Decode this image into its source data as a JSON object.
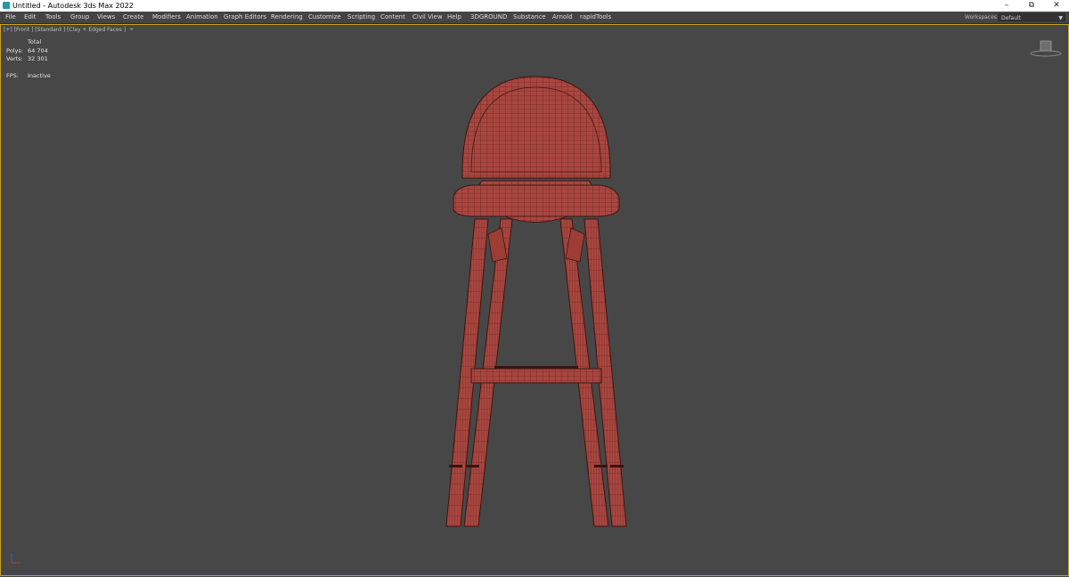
{
  "window": {
    "title": "Untitled - Autodesk 3ds Max 2022",
    "min": "–",
    "restore": "⧉",
    "close": "✕"
  },
  "menu": [
    "File",
    "Edit",
    "Tools",
    "Group",
    "Views",
    "Create",
    "Modifiers",
    "Animation",
    "Graph Editors",
    "Rendering",
    "Customize",
    "Scripting",
    "Content",
    "Civil View",
    "Help",
    "3DGROUND",
    "Substance",
    "Arnold",
    "rapidTools"
  ],
  "workspaces": {
    "label": "Workspaces:",
    "value": "Default"
  },
  "viewport": {
    "label": "[+] [Front ] [Standard ] [Clay + Edged Faces ]",
    "stats": {
      "total_label": "Total",
      "polys_label": "Polys:",
      "polys": "64 704",
      "verts_label": "Verts:",
      "verts": "32 301",
      "fps_label": "FPS:",
      "fps": "Inactive"
    }
  },
  "colors": {
    "viewport_bg": "#474747",
    "model": "#a8463f",
    "active_border": "#c9a21f"
  }
}
